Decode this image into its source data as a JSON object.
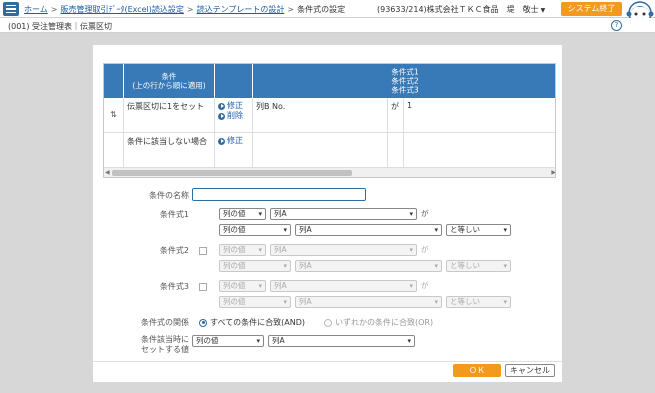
{
  "header": {
    "breadcrumbs": [
      "ホーム",
      "販売管理取引ﾃﾞｰﾀ(Excel)読込設定",
      "読込テンプレートの設計"
    ],
    "current": "条件式の設定",
    "user": "(93633/214)株式会社ＴＫＣ食品　堤　敬士",
    "system_end": "システム終了"
  },
  "subheader": {
    "title": "(001) 受注管理表｜伝票区切",
    "help_icon": "?"
  },
  "grid": {
    "col_condition": "条件\n(上の行から順に適用)",
    "col_expr": "条件式1\n条件式2\n条件式3",
    "rows": [
      {
        "handle": "⇅",
        "condition": "伝票区切に1をセット",
        "edit": "修正",
        "delete": "削除",
        "col": "列B No.",
        "op": "が",
        "val": "1"
      },
      {
        "condition": "条件に該当しない場合",
        "edit": "修正"
      }
    ]
  },
  "form": {
    "name_label": "条件の名称",
    "name_value": "",
    "expr1_label": "条件式1",
    "expr2_label": "条件式2",
    "expr3_label": "条件式3",
    "col_value_opt": "列の値",
    "col_a": "列A",
    "ga": "が",
    "equals": "と等しい",
    "relation_label": "条件式の関係",
    "rel_and": "すべての条件に合致(AND)",
    "rel_or": "いずれかの条件に合致(OR)",
    "set_label_1": "条件該当時に",
    "set_label_2": "セットする値",
    "set_type": "列の値",
    "set_col": "列A"
  },
  "buttons": {
    "ok": "ＯＫ",
    "cancel": "キャンセル"
  },
  "colors": {
    "accent": "#f29a1d",
    "header_blue": "#3879b8",
    "link": "#1a5ea8"
  }
}
